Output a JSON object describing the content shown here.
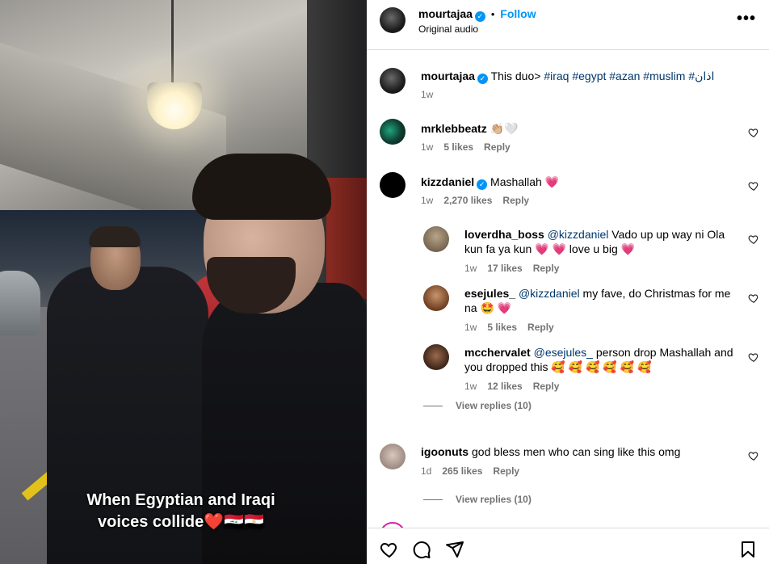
{
  "video": {
    "caption_line1": "When Egyptian and Iraqi",
    "caption_line2": "voices collide",
    "caption_emoji": "❤️🇮🇶🇪🇬"
  },
  "header": {
    "username": "mourtajaa",
    "follow_label": "Follow",
    "audio": "Original audio",
    "more_icon": "more-options-icon"
  },
  "post": {
    "username": "mourtajaa",
    "text": "This duo>",
    "hashtags": "#iraq #egypt #azan #muslim #اذان",
    "time": "1w"
  },
  "comments": [
    {
      "username": "mrklebbeatz",
      "verified": false,
      "mention": "",
      "text": "👏🏼🤍",
      "time": "1w",
      "likes": "5 likes",
      "reply": "Reply"
    },
    {
      "username": "kizzdaniel",
      "verified": true,
      "mention": "",
      "text": "Mashallah 💗",
      "time": "1w",
      "likes": "2,270 likes",
      "reply": "Reply"
    },
    {
      "username": "loverdha_boss",
      "verified": false,
      "mention": "@kizzdaniel",
      "text": " Vado up up way ni Ola kun fa ya kun 💗 💗  love u big 💗",
      "time": "1w",
      "likes": "17 likes",
      "reply": "Reply"
    },
    {
      "username": "esejules_",
      "verified": false,
      "mention": "@kizzdaniel",
      "text": " my fave, do Christmas for me na 🤩 💗",
      "time": "1w",
      "likes": "5 likes",
      "reply": "Reply"
    },
    {
      "username": "mcchervalet",
      "verified": false,
      "mention": "@esejules_",
      "text": " person drop Mashallah and you dropped this 🥰 🥰 🥰 🥰 🥰 🥰",
      "time": "1w",
      "likes": "12 likes",
      "reply": "Reply"
    },
    {
      "username": "igoonuts",
      "verified": false,
      "mention": "",
      "text": "god bless men who can sing like this omg",
      "time": "1d",
      "likes": "265 likes",
      "reply": "Reply"
    }
  ],
  "view_replies": [
    "View replies (10)",
    "View replies (10)"
  ],
  "colors": {
    "accent": "#0095f6",
    "link": "#00376b",
    "muted": "#737373",
    "heart": "#ed4956"
  }
}
